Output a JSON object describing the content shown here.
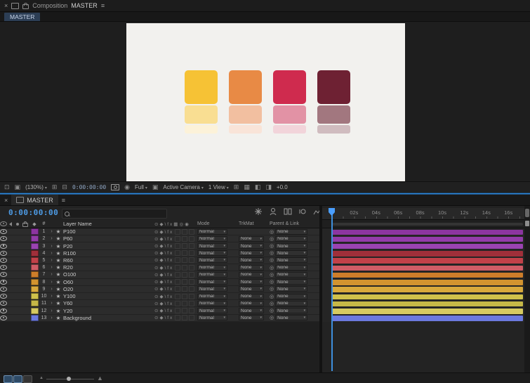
{
  "icons": {
    "close": "×",
    "menu": "≡",
    "star": "★",
    "caret": "›",
    "dropdown": "▾",
    "pickwhip": "◎",
    "label_header": "◆",
    "row_switches": "⊙◆\\fx",
    "header_switches": "⊙◆\\fx▦◎◉"
  },
  "comp_panel": {
    "panel_title": "Composition",
    "comp_name": "MASTER",
    "active_tab": "MASTER",
    "toolbar": {
      "zoom": "(130%)",
      "timecode": "0:00:00:00",
      "resolution": "Full",
      "camera_view": "Active Camera",
      "view_layout": "1 View",
      "exposure": "+0.0"
    },
    "canvas_bg": "#f2f1ee",
    "swatches": [
      {
        "name": "yellow",
        "main": "#f6c235",
        "mid": "#f9de92",
        "light": "#fcf2d9"
      },
      {
        "name": "orange",
        "main": "#e88a45",
        "mid": "#f2bfa0",
        "light": "#f9e4d8"
      },
      {
        "name": "red",
        "main": "#cf2b4e",
        "mid": "#e292a5",
        "light": "#f2d4da"
      },
      {
        "name": "maroon",
        "main": "#6e2133",
        "mid": "#a2777f",
        "light": "#d0bcbf"
      }
    ]
  },
  "timeline_panel": {
    "tab": "MASTER",
    "timecode": "0:00:00:00",
    "ruler_ticks": [
      "02s",
      "04s",
      "06s",
      "08s",
      "10s",
      "12s",
      "14s",
      "16s"
    ],
    "headers": {
      "hash": "#",
      "layer_name": "Layer Name",
      "mode": "Mode",
      "trkmat": "TrkMat",
      "parent": "Parent & Link"
    },
    "layers": [
      {
        "num": "1",
        "name": "P100",
        "color": "#8c35a0",
        "mode": "Normal",
        "trkmat": "",
        "parent": "None"
      },
      {
        "num": "2",
        "name": "P60",
        "color": "#933caa",
        "mode": "Normal",
        "trkmat": "None",
        "parent": "None"
      },
      {
        "num": "3",
        "name": "P20",
        "color": "#9a43b2",
        "mode": "Normal",
        "trkmat": "None",
        "parent": "None"
      },
      {
        "num": "4",
        "name": "R100",
        "color": "#a02f3a",
        "mode": "Normal",
        "trkmat": "None",
        "parent": "None"
      },
      {
        "num": "5",
        "name": "R60",
        "color": "#c24149",
        "mode": "Normal",
        "trkmat": "None",
        "parent": "None"
      },
      {
        "num": "6",
        "name": "R20",
        "color": "#d05c66",
        "mode": "Normal",
        "trkmat": "None",
        "parent": "None"
      },
      {
        "num": "7",
        "name": "O100",
        "color": "#cd7d2a",
        "mode": "Normal",
        "trkmat": "None",
        "parent": "None"
      },
      {
        "num": "8",
        "name": "O60",
        "color": "#d2932f",
        "mode": "Normal",
        "trkmat": "None",
        "parent": "None"
      },
      {
        "num": "9",
        "name": "O20",
        "color": "#d8a93c",
        "mode": "Normal",
        "trkmat": "None",
        "parent": "None"
      },
      {
        "num": "10",
        "name": "Y100",
        "color": "#cfc14b",
        "mode": "Normal",
        "trkmat": "None",
        "parent": "None"
      },
      {
        "num": "11",
        "name": "Y60",
        "color": "#c6b847",
        "mode": "Normal",
        "trkmat": "None",
        "parent": "None"
      },
      {
        "num": "12",
        "name": "Y20",
        "color": "#d6ca60",
        "mode": "Normal",
        "trkmat": "None",
        "parent": "None"
      },
      {
        "num": "13",
        "name": "Background",
        "color": "#6b79de",
        "mode": "Normal",
        "trkmat": "None",
        "parent": "None"
      }
    ]
  },
  "colors": {
    "accent_blue": "#3e8fdd",
    "timecode_blue": "#4e9ce6"
  }
}
